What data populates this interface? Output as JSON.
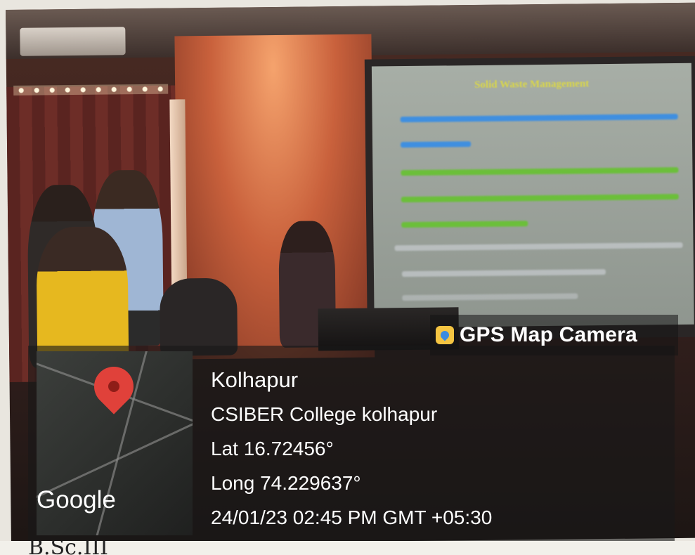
{
  "slide": {
    "title": "Solid Waste Management"
  },
  "overlay": {
    "app_title": "GPS Map Camera",
    "map_label": "Google",
    "city": "Kolhapur",
    "place": "CSIBER College kolhapur",
    "latitude": "Lat 16.72456°",
    "longitude": "Long 74.229637°",
    "datetime": "24/01/23 02:45 PM GMT +05:30"
  },
  "caption": {
    "handwriting": "B.Sc.III"
  }
}
